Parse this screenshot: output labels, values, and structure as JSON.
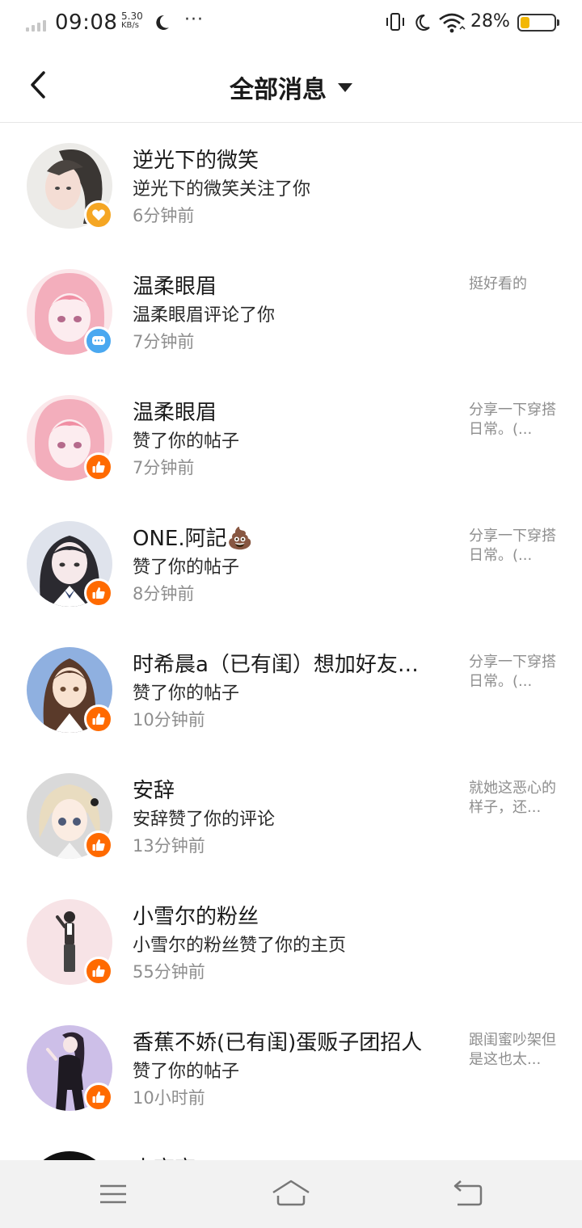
{
  "status_bar": {
    "time": "09:08",
    "speed_value": "5.30",
    "speed_unit": "KB/s",
    "dots": "···",
    "battery_percent": "28%",
    "battery_level": 0.28,
    "battery_color": "#f2b705"
  },
  "header": {
    "back_icon": "chevron-left-icon",
    "title": "全部消息",
    "dropdown_icon": "caret-down-icon"
  },
  "badge_colors": {
    "heart": "#f5a623",
    "comment": "#4aa8f0",
    "like": "#ff6a00"
  },
  "messages": [
    {
      "name": "逆光下的微笑",
      "action": "逆光下的微笑关注了你",
      "time": "6分钟前",
      "preview": "",
      "badge": "heart-icon"
    },
    {
      "name": "温柔眼眉",
      "action": "温柔眼眉评论了你",
      "time": "7分钟前",
      "preview": "挺好看的",
      "badge": "comment-icon"
    },
    {
      "name": "温柔眼眉",
      "action": "赞了你的帖子",
      "time": "7分钟前",
      "preview": "分享一下穿搭日常。(...",
      "badge": "thumbs-up-icon"
    },
    {
      "name": "ONE.阿記💩",
      "action": "赞了你的帖子",
      "time": "8分钟前",
      "preview": "分享一下穿搭日常。(...",
      "badge": "thumbs-up-icon"
    },
    {
      "name": "时希晨a（已有闺）想加好友…",
      "action": "赞了你的帖子",
      "time": "10分钟前",
      "preview": "分享一下穿搭日常。(...",
      "badge": "thumbs-up-icon"
    },
    {
      "name": "安辞",
      "action": "安辞赞了你的评论",
      "time": "13分钟前",
      "preview": "就她这恶心的样子，还...",
      "badge": "thumbs-up-icon"
    },
    {
      "name": "小雪尔的粉丝",
      "action": "小雪尔的粉丝赞了你的主页",
      "time": "55分钟前",
      "preview": "",
      "badge": "thumbs-up-icon"
    },
    {
      "name": "香蕉不娇(已有闺)蛋贩子团招人",
      "action": "赞了你的帖子",
      "time": "10小时前",
      "preview": "跟闺蜜吵架但是这也太...",
      "badge": "thumbs-up-icon"
    },
    {
      "name": "小商商",
      "action": "",
      "time": "",
      "preview": "",
      "badge": ""
    }
  ],
  "nav_bar": {
    "menu_icon": "menu-icon",
    "home_icon": "home-icon",
    "back_icon": "back-arrow-icon"
  }
}
